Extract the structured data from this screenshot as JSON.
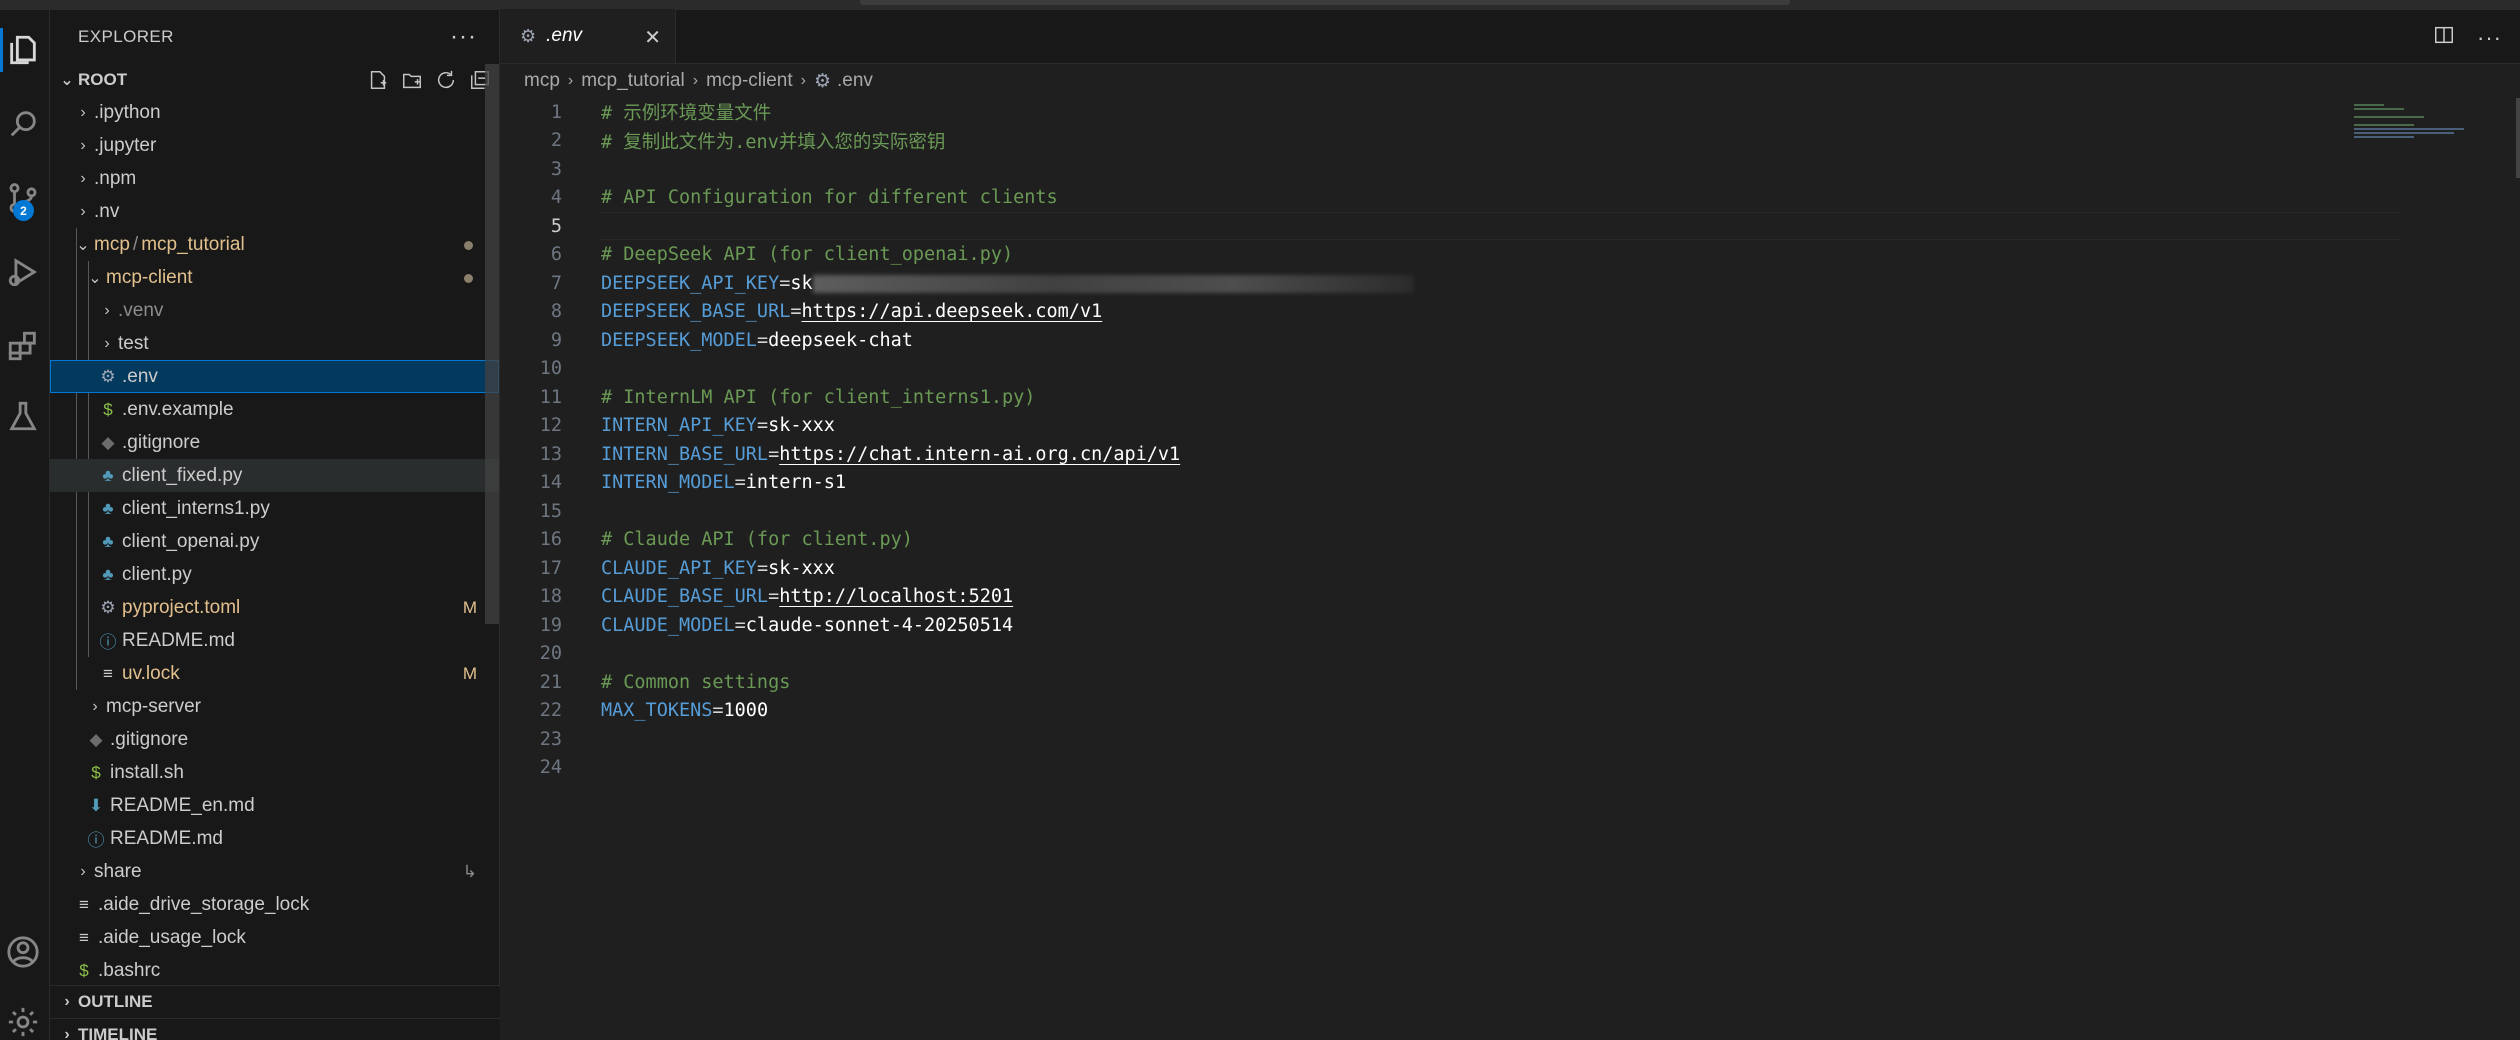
{
  "sidebar": {
    "title": "EXPLORER",
    "root_label": "ROOT",
    "items": [
      {
        "label": ".ipython"
      },
      {
        "label": ".jupyter"
      },
      {
        "label": ".npm"
      },
      {
        "label": ".nv"
      },
      {
        "label_a": "mcp",
        "label_sep": "/",
        "label_b": "mcp_tutorial"
      },
      {
        "label": "mcp-client"
      },
      {
        "label": ".venv"
      },
      {
        "label": "test"
      },
      {
        "label": ".env"
      },
      {
        "label": ".env.example"
      },
      {
        "label": ".gitignore"
      },
      {
        "label": "client_fixed.py"
      },
      {
        "label": "client_interns1.py"
      },
      {
        "label": "client_openai.py"
      },
      {
        "label": "client.py"
      },
      {
        "label": "pyproject.toml",
        "badge": "M"
      },
      {
        "label": "README.md"
      },
      {
        "label": "uv.lock",
        "badge": "M"
      },
      {
        "label": "mcp-server"
      },
      {
        "label": ".gitignore"
      },
      {
        "label": "install.sh"
      },
      {
        "label": "README_en.md"
      },
      {
        "label": "README.md"
      },
      {
        "label": "share"
      },
      {
        "label": ".aide_drive_storage_lock"
      },
      {
        "label": ".aide_usage_lock"
      },
      {
        "label": ".bashrc"
      }
    ],
    "outline_label": "OUTLINE",
    "timeline_label": "TIMELINE"
  },
  "activity": {
    "scm_badge": "2"
  },
  "tab": {
    "label": ".env",
    "close": "✕"
  },
  "breadcrumb": [
    "mcp",
    "mcp_tutorial",
    "mcp-client",
    ".env"
  ],
  "editor": {
    "current_line": 5,
    "lines": [
      {
        "n": "1",
        "comment": "# 示例环境变量文件"
      },
      {
        "n": "2",
        "comment": "# 复制此文件为.env并填入您的实际密钥"
      },
      {
        "n": "3"
      },
      {
        "n": "4",
        "comment": "# API Configuration for different clients"
      },
      {
        "n": "5"
      },
      {
        "n": "6",
        "comment": "# DeepSeek API (for client_openai.py)"
      },
      {
        "n": "7",
        "key": "DEEPSEEK_API_KEY",
        "eq": "=",
        "value": "sk",
        "redacted": true
      },
      {
        "n": "8",
        "key": "DEEPSEEK_BASE_URL",
        "eq": "=",
        "url": "https://api.deepseek.com/v1"
      },
      {
        "n": "9",
        "key": "DEEPSEEK_MODEL",
        "eq": "=",
        "value": "deepseek-chat"
      },
      {
        "n": "10"
      },
      {
        "n": "11",
        "comment": "# InternLM API (for client_interns1.py)"
      },
      {
        "n": "12",
        "key": "INTERN_API_KEY",
        "eq": "=",
        "value": "sk-xxx"
      },
      {
        "n": "13",
        "key": "INTERN_BASE_URL",
        "eq": "=",
        "url": "https://chat.intern-ai.org.cn/api/v1"
      },
      {
        "n": "14",
        "key": "INTERN_MODEL",
        "eq": "=",
        "value": "intern-s1"
      },
      {
        "n": "15"
      },
      {
        "n": "16",
        "comment": "# Claude API (for client.py)"
      },
      {
        "n": "17",
        "key": "CLAUDE_API_KEY",
        "eq": "=",
        "value": "sk-xxx"
      },
      {
        "n": "18",
        "key": "CLAUDE_BASE_URL",
        "eq": "=",
        "url": "http://localhost:5201"
      },
      {
        "n": "19",
        "key": "CLAUDE_MODEL",
        "eq": "=",
        "value": "claude-sonnet-4-20250514"
      },
      {
        "n": "20"
      },
      {
        "n": "21",
        "comment": "# Common settings"
      },
      {
        "n": "22",
        "key": "MAX_TOKENS",
        "eq": "=",
        "value": "1000"
      },
      {
        "n": "23"
      },
      {
        "n": "24"
      }
    ]
  },
  "colors": {
    "accent": "#0078d4",
    "modified": "#e2c08d",
    "comment": "#6a9955",
    "key": "#569cd6"
  }
}
